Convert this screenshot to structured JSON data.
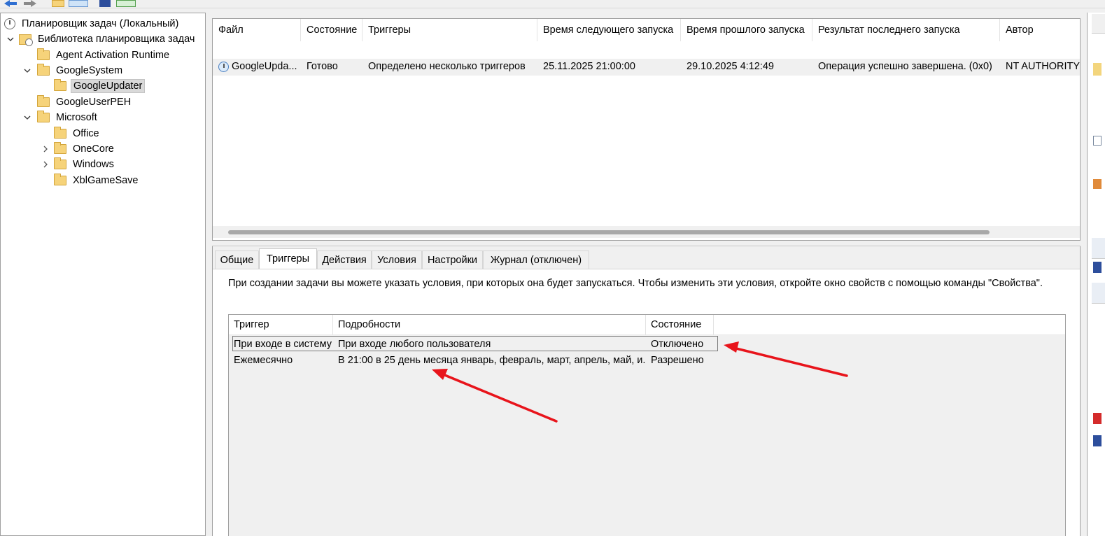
{
  "tree": {
    "root": "Планировщик задач (Локальный)",
    "library": "Библиотека планировщика задач",
    "items": [
      {
        "label": "Agent Activation Runtime"
      },
      {
        "label": "GoogleSystem"
      },
      {
        "label": "GoogleUpdater"
      },
      {
        "label": "GoogleUserPEH"
      },
      {
        "label": "Microsoft"
      },
      {
        "label": "Office"
      },
      {
        "label": "OneCore"
      },
      {
        "label": "Windows"
      },
      {
        "label": "XblGameSave"
      }
    ]
  },
  "task_list": {
    "columns": [
      "Файл",
      "Состояние",
      "Триггеры",
      "Время следующего запуска",
      "Время прошлого запуска",
      "Результат последнего запуска",
      "Автор"
    ],
    "row": {
      "name": "GoogleUpda...",
      "state": "Готово",
      "triggers": "Определено несколько триггеров",
      "next_run": "25.11.2025 21:00:00",
      "last_run": "29.10.2025 4:12:49",
      "result": "Операция успешно завершена. (0x0)",
      "author": "NT AUTHORITY\\S"
    }
  },
  "tabs": [
    "Общие",
    "Триггеры",
    "Действия",
    "Условия",
    "Настройки",
    "Журнал (отключен)"
  ],
  "triggers_tab": {
    "description": "При создании задачи вы можете указать условия, при которых она будет запускаться.  Чтобы изменить эти условия, откройте окно свойств с помощью команды \"Свойства\".",
    "columns": [
      "Триггер",
      "Подробности",
      "Состояние"
    ],
    "rows": [
      {
        "trigger": "При входе в систему",
        "details": "При входе любого пользователя",
        "state": "Отключено"
      },
      {
        "trigger": "Ежемесячно",
        "details": "В 21:00 в 25 день месяца январь, февраль, март, апрель, май, и...",
        "state": "Разрешено"
      }
    ]
  },
  "colors": {
    "annotation_arrow": "#e8141b",
    "folder": "#f6d37a"
  }
}
